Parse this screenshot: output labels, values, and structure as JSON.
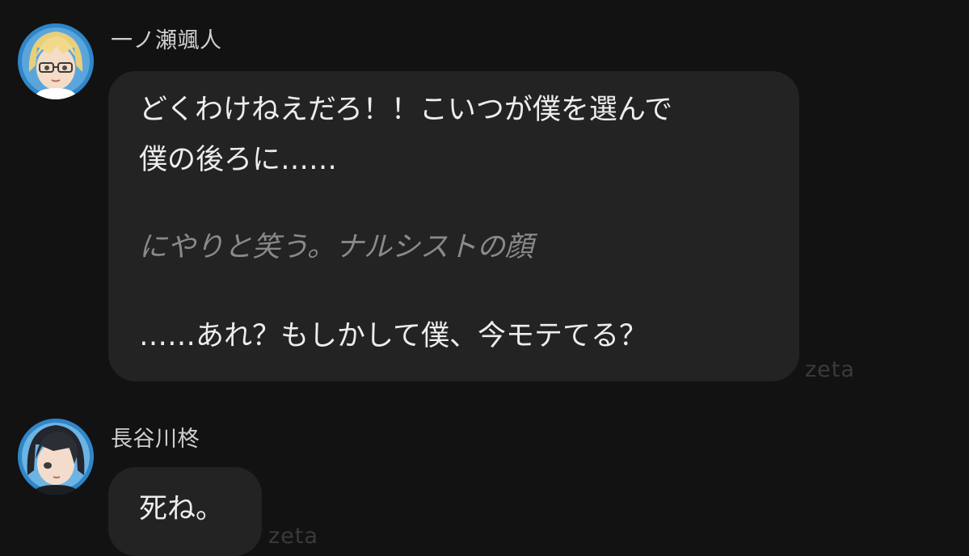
{
  "messages": [
    {
      "sender": "一ノ瀬颯人",
      "avatar_icon": "blond-glasses-character-avatar",
      "lines": [
        {
          "text": "どくわけねえだろ！！こいつが僕を選んで",
          "style": "speech"
        },
        {
          "text": "僕の後ろに……",
          "style": "speech"
        },
        {
          "text": "にやりと笑う。ナルシストの顔",
          "style": "narration"
        },
        {
          "text": "……あれ？もしかして僕、今モテてる？",
          "style": "speech"
        }
      ],
      "watermark": "zeta"
    },
    {
      "sender": "長谷川柊",
      "avatar_icon": "dark-haired-character-avatar",
      "lines": [
        {
          "text": "死ね。",
          "style": "speech"
        }
      ],
      "watermark": "zeta"
    }
  ],
  "colors": {
    "background": "#121212",
    "bubble": "#232323",
    "text": "#ededed",
    "narration_text": "#8a8a8a",
    "sender_name": "#cfcfcf",
    "avatar_ring": "#2a7fc0",
    "watermark": "#3a3a3a"
  }
}
